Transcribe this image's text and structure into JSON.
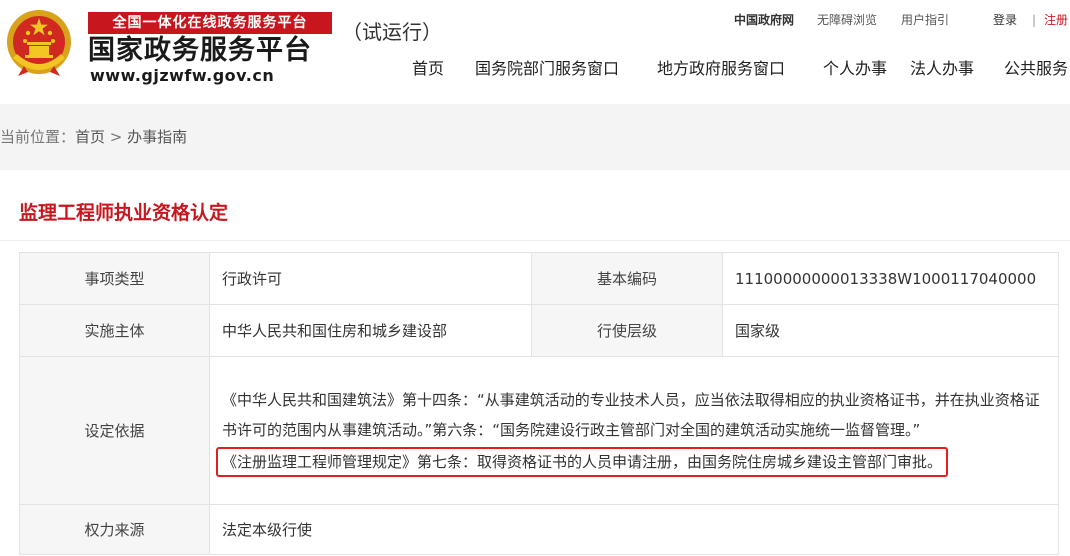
{
  "header": {
    "logo_banner": "全国一体化在线政务服务平台",
    "logo_title": "国家政务服务平台",
    "logo_url": "www.gjzwfw.gov.cn",
    "trial_label": "（试运行）",
    "top_links": {
      "gov": "中国政府网",
      "accessibility": "无障碍浏览",
      "guide": "用户指引",
      "login": "登录",
      "separator": "|",
      "register": "注册"
    },
    "nav": [
      "首页",
      "国务院部门服务窗口",
      "地方政府服务窗口",
      "个人办事",
      "法人办事",
      "公共服务"
    ]
  },
  "breadcrumb": {
    "prefix": "当前位置：",
    "home": "首页",
    "arrow": " > ",
    "current": "办事指南"
  },
  "content": {
    "title": "监理工程师执业资格认定",
    "table": {
      "item_type_label": "事项类型",
      "item_type_value": "行政许可",
      "code_label": "基本编码",
      "code_value": "11100000000013338W1000117040000",
      "subject_label": "实施主体",
      "subject_value": "中华人民共和国住房和城乡建设部",
      "level_label": "行使层级",
      "level_value": "国家级",
      "basis_label": "设定依据",
      "basis_text": "《中华人民共和国建筑法》第十四条：“从事建筑活动的专业技术人员，应当依法取得相应的执业资格证书，并在执业资格证书许可的范围内从事建筑活动。”第六条：“国务院建设行政主管部门对全国的建筑活动实施统一监督管理。”",
      "basis_highlight": "《注册监理工程师管理规定》第七条：取得资格证书的人员申请注册，由国务院住房城乡建设主管部门审批。",
      "source_label": "权力来源",
      "source_value": "法定本级行使"
    }
  },
  "colors": {
    "brand_red": "#c8161e",
    "highlight_border": "#e02020",
    "label_bg": "#f6f6f6",
    "crumb_bg": "#f4f4f4"
  },
  "icons": {
    "emblem": "national-emblem-icon"
  }
}
